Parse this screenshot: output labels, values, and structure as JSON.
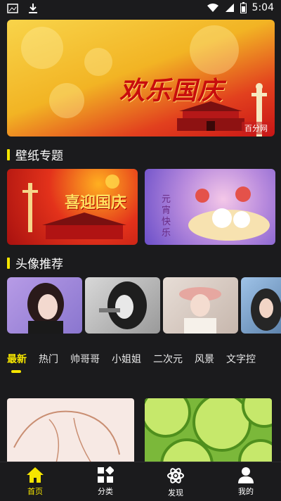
{
  "status_bar": {
    "time": "5:04",
    "icons": [
      "image-icon",
      "download-icon",
      "wifi-icon",
      "battery-icon"
    ]
  },
  "banner": {
    "title": "欢乐国庆",
    "watermark": "百分网"
  },
  "sections": {
    "wallpaper": {
      "title": "壁纸专题",
      "cards": [
        {
          "caption": "喜迎国庆"
        },
        {
          "caption": "元宵快乐"
        }
      ]
    },
    "avatar": {
      "title": "头像推荐"
    }
  },
  "tabs": [
    {
      "label": "最新",
      "active": true
    },
    {
      "label": "热门"
    },
    {
      "label": "帅哥哥"
    },
    {
      "label": "小姐姐"
    },
    {
      "label": "二次元"
    },
    {
      "label": "风景"
    },
    {
      "label": "文字控"
    }
  ],
  "bottom_nav": [
    {
      "label": "首页",
      "icon": "home-icon",
      "active": true
    },
    {
      "label": "分类",
      "icon": "category-icon"
    },
    {
      "label": "发现",
      "icon": "atom-icon"
    },
    {
      "label": "我的",
      "icon": "profile-icon"
    }
  ],
  "colors": {
    "accent": "#f5e500",
    "background": "#1b1b1d"
  }
}
